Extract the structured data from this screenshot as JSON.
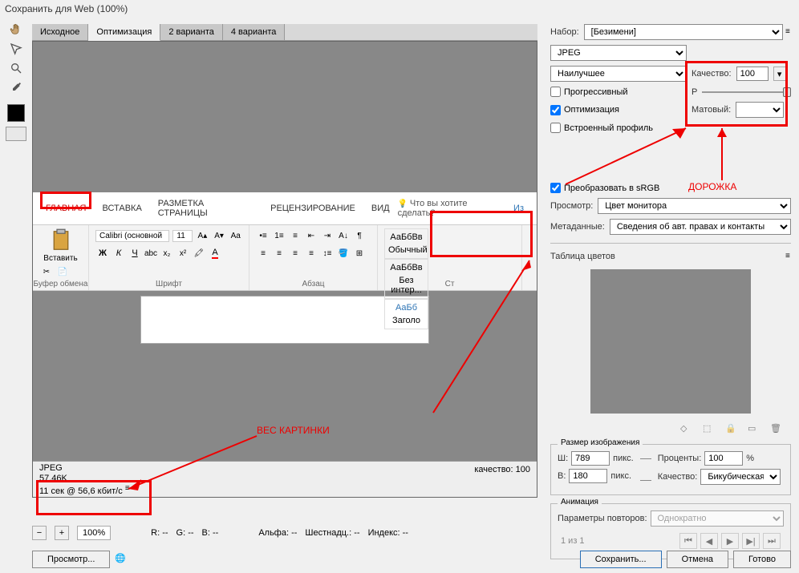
{
  "window_title": "Сохранить для Web (100%)",
  "tabs": [
    "Исходное",
    "Оптимизация",
    "2 варианта",
    "4 варианта"
  ],
  "active_tab": "Оптимизация",
  "preview_info": {
    "format": "JPEG",
    "size": "57,46K",
    "time": "11 сек @ 56,6 кбит/с",
    "quality_label": "качество: 100"
  },
  "bottom_bar": {
    "zoom": "100%",
    "R": "R: --",
    "G": "G: --",
    "B": "B: --",
    "alpha": "Альфа: --",
    "hex": "Шестнадц.: --",
    "index": "Индекс: --"
  },
  "word": {
    "tabs": [
      "ГЛАВНАЯ",
      "ВСТАВКА",
      "РАЗМЕТКА СТРАНИЦЫ",
      "РЕЦЕНЗИРОВАНИЕ",
      "ВИД"
    ],
    "help_text": "Что вы хотите сделать?",
    "paste_label": "Вставить",
    "clipboard_group": "Буфер обмена",
    "font_name": "Calibri (основной",
    "font_size": "11",
    "font_group": "Шрифт",
    "para_group": "Абзац",
    "style1_preview": "АаБбВв",
    "style1_name": "Обычный",
    "style2_preview": "АаБбВв",
    "style2_name": "Без интер...",
    "style3_preview": "АаБб",
    "style3_name": "Заголо",
    "styles_group": "Ст",
    "edit": "Из"
  },
  "right": {
    "set_label": "Набор:",
    "set_value": "[Безимени]",
    "format": "JPEG",
    "quality_preset": "Наилучшее",
    "quality_label": "Качество:",
    "quality_value": "100",
    "progressive": "Прогрессивный",
    "blur_label": "Р",
    "optimized": "Оптимизация",
    "matte_label": "Матовый:",
    "embed_profile": "Встроенный профиль",
    "convert_srgb": "Преобразовать в sRGB",
    "preview_label": "Просмотр:",
    "preview_value": "Цвет монитора",
    "metadata_label": "Метаданные:",
    "metadata_value": "Сведения об авт. правах и контакты",
    "color_table": "Таблица цветов",
    "image_size": "Размер изображения",
    "w_label": "Ш:",
    "w_value": "789",
    "h_label": "В:",
    "h_value": "180",
    "px": "пикс.",
    "percent_label": "Проценты:",
    "percent_value": "100",
    "pct": "%",
    "quality2_label": "Качество:",
    "quality2_value": "Бикубическая",
    "animation": "Анимация",
    "loop_label": "Параметры повторов:",
    "loop_value": "Однократно",
    "frame": "1 из 1"
  },
  "footer": {
    "preview": "Просмотр...",
    "save": "Сохранить...",
    "cancel": "Отмена",
    "done": "Готово"
  },
  "annotations": {
    "weight": "ВЕС КАРТИНКИ",
    "track": "ДОРОЖКА"
  }
}
